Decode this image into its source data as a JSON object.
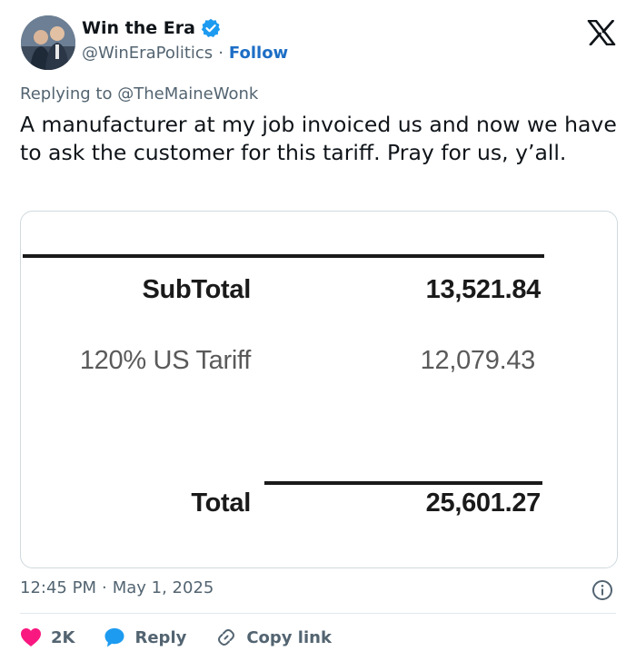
{
  "header": {
    "name": "Win the Era",
    "handle": "@WinEraPolitics",
    "separator": "·",
    "follow_label": "Follow"
  },
  "reply": {
    "prefix": "Replying to",
    "target": "@TheMaineWonk"
  },
  "tweet": {
    "text": "A manufacturer at my job invoiced us and now we have to ask the customer for this tariff. Pray for us, y’all."
  },
  "invoice": {
    "subtotal_label": "SubTotal",
    "subtotal_value": "13,521.84",
    "tariff_label": "120% US Tariff",
    "tariff_value": "12,079.43",
    "total_label": "Total",
    "total_value": "25,601.27"
  },
  "meta": {
    "time": "12:45 PM",
    "separator": "·",
    "date": "May 1, 2025"
  },
  "actions": {
    "like_count": "2K",
    "reply_label": "Reply",
    "copy_label": "Copy link"
  },
  "colors": {
    "verified": "#1d9bf0",
    "like": "#f91880",
    "reply": "#1d9bf0",
    "follow": "#1d6ec5"
  }
}
